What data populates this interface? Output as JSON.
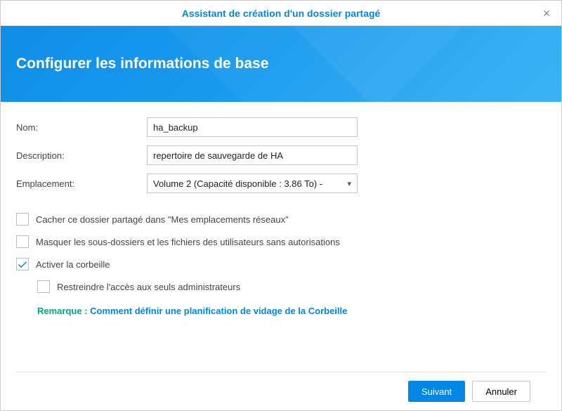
{
  "titlebar": {
    "title": "Assistant de création d'un dossier partagé"
  },
  "banner": {
    "title": "Configurer les informations de base"
  },
  "form": {
    "name_label": "Nom:",
    "name_value": "ha_backup",
    "description_label": "Description:",
    "description_value": "repertoire de sauvegarde de HA",
    "location_label": "Emplacement:",
    "location_value": "Volume 2 (Capacité disponible :  3.86 To) -"
  },
  "checkboxes": {
    "hide_folder": {
      "label": "Cacher ce dossier partagé dans \"Mes emplacements réseaux\"",
      "checked": false
    },
    "hide_subfolders": {
      "label": "Masquer les sous-dossiers et les fichiers des utilisateurs sans autorisations",
      "checked": false
    },
    "recycle_bin": {
      "label": "Activer la corbeille",
      "checked": true
    },
    "restrict_admin": {
      "label": "Restreindre l'accès aux seuls administrateurs",
      "checked": false
    }
  },
  "note": {
    "label": "Remarque : ",
    "link": "Comment définir une planification de vidage de la Corbeille"
  },
  "footer": {
    "next": "Suivant",
    "cancel": "Annuler"
  }
}
